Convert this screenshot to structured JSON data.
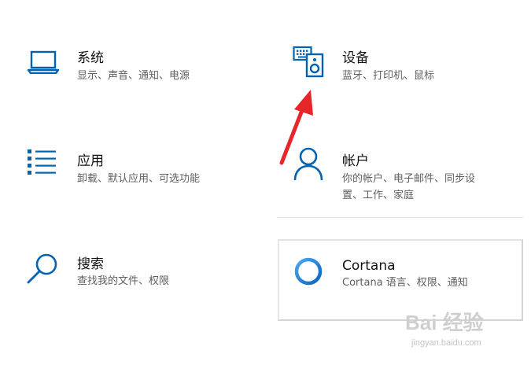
{
  "tiles": {
    "system": {
      "title": "系统",
      "desc": "显示、声音、通知、电源",
      "icon": "laptop-icon"
    },
    "devices": {
      "title": "设备",
      "desc": "蓝牙、打印机、鼠标",
      "icon": "devices-icon"
    },
    "apps": {
      "title": "应用",
      "desc": "卸载、默认应用、可选功能",
      "icon": "apps-list-icon"
    },
    "accounts": {
      "title": "帐户",
      "desc_line1": "你的帐户、电子邮件、同步设",
      "desc_line2": "置、工作、家庭",
      "icon": "person-icon"
    },
    "search": {
      "title": "搜索",
      "desc": "查找我的文件、权限",
      "icon": "search-icon"
    },
    "cortana": {
      "title": "Cortana",
      "desc": "Cortana 语言、权限、通知",
      "icon": "cortana-ring-icon"
    }
  },
  "annotation": {
    "arrow_color": "#e8262a",
    "icon": "red-arrow-icon"
  },
  "watermark": {
    "logo_text": "Bai 经验",
    "url": "jingyan.baidu.com"
  },
  "colors": {
    "accent": "#0063b1",
    "title": "#111111",
    "description": "#5f5f5f"
  }
}
